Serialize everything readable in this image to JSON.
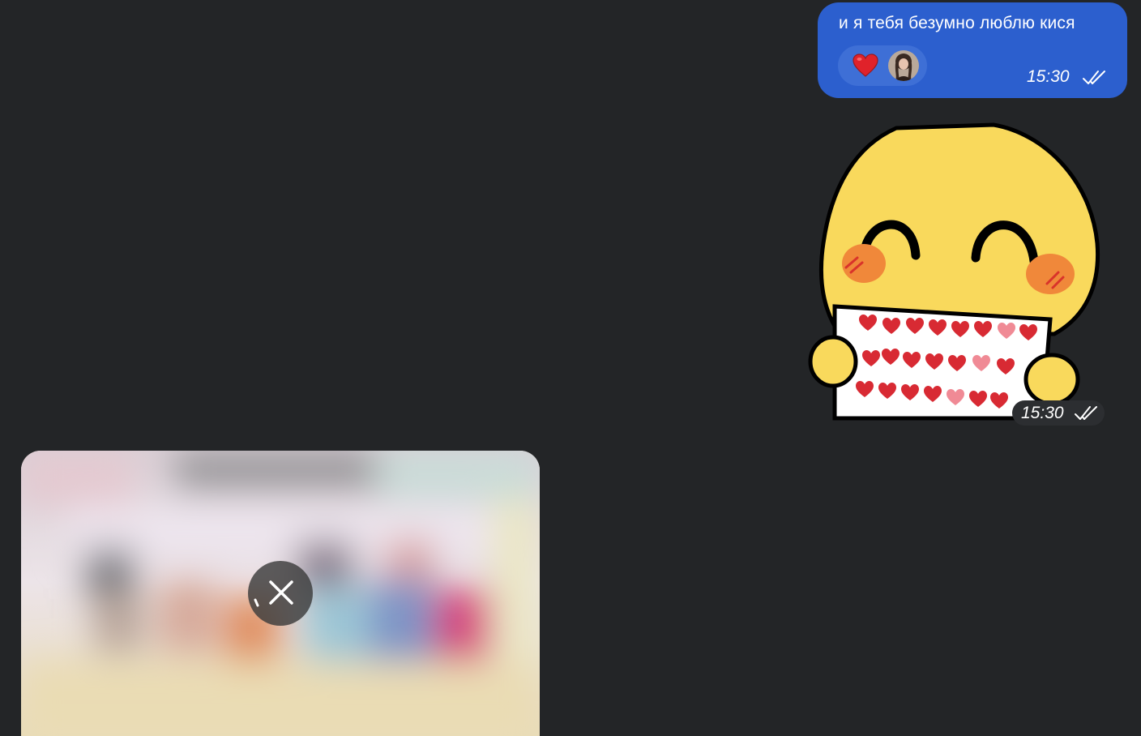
{
  "messages": {
    "outgoing_text": {
      "text": "и я тебя безумно люблю кися",
      "time": "15:30",
      "status_icon": "double-check-icon",
      "reaction": {
        "emoji_icon": "red-heart-icon",
        "reactor_avatar": "avatar"
      },
      "bubble_color": "#2c5fce"
    },
    "sticker": {
      "description_icon": "blushing-emoji-holding-heart-letter-sticker",
      "time": "15:30",
      "status_icon": "double-check-icon"
    },
    "media": {
      "state": "downloading",
      "control_icon": "cancel-download-icon"
    }
  },
  "colors": {
    "background": "#232527",
    "accent": "#2c5fce"
  }
}
